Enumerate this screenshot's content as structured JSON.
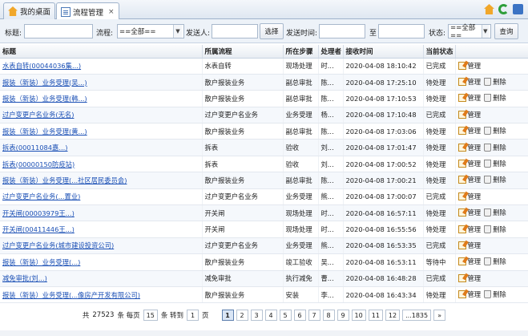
{
  "tabs": [
    {
      "label": "我的桌面",
      "icon": "home-icon"
    },
    {
      "label": "流程管理",
      "icon": "document-icon",
      "close": "×"
    }
  ],
  "search": {
    "title_label": "标题:",
    "flow_label": "流程:",
    "flow_value": "==全部==",
    "sender_label": "发送人:",
    "choose_button": "选择",
    "time_label": "发送时间:",
    "to_label": "至",
    "status_label": "状态:",
    "status_value": "==全部==",
    "query_button": "查询"
  },
  "columns": [
    "标题",
    "所属流程",
    "所在步骤",
    "处理者",
    "接收时间",
    "当前状态",
    ""
  ],
  "actions": {
    "manage": "管理",
    "delete": "删除"
  },
  "rows": [
    {
      "title": "水表自转(00044036集...)",
      "flow": "水表自转",
      "step": "现场处理",
      "handler": "时...",
      "time": "2020-04-08 18:10:42",
      "status": "已完成",
      "delete": false
    },
    {
      "title": "报装（新装）业务受理(吴...)",
      "flow": "散户报装业务",
      "step": "副总审批",
      "handler": "陈...",
      "time": "2020-04-08 17:25:10",
      "status": "待处理",
      "delete": true
    },
    {
      "title": "报装（新装）业务受理(韩...)",
      "flow": "散户报装业务",
      "step": "副总审批",
      "handler": "陈...",
      "time": "2020-04-08 17:10:53",
      "status": "待处理",
      "delete": true
    },
    {
      "title": "过户变更户名业务(无名)",
      "flow": "过户变更户名业务",
      "step": "业务受理",
      "handler": "杨...",
      "time": "2020-04-08 17:10:48",
      "status": "已完成",
      "delete": false
    },
    {
      "title": "报装（新装）业务受理(黄...)",
      "flow": "散户报装业务",
      "step": "副总审批",
      "handler": "陈...",
      "time": "2020-04-08 17:03:06",
      "status": "待处理",
      "delete": true
    },
    {
      "title": "拆表(00011084嘉...)",
      "flow": "拆表",
      "step": "验收",
      "handler": "刘...",
      "time": "2020-04-08 17:01:47",
      "status": "待处理",
      "delete": true
    },
    {
      "title": "拆表(00000150防疫站)",
      "flow": "拆表",
      "step": "验收",
      "handler": "刘...",
      "time": "2020-04-08 17:00:52",
      "status": "待处理",
      "delete": true
    },
    {
      "title": "报装（新装）业务受理(...社区居民委员会)",
      "flow": "散户报装业务",
      "step": "副总审批",
      "handler": "陈...",
      "time": "2020-04-08 17:00:21",
      "status": "待处理",
      "delete": true
    },
    {
      "title": "过户变更户名业务(...置业)",
      "flow": "过户变更户名业务",
      "step": "业务受理",
      "handler": "熊...",
      "time": "2020-04-08 17:00:07",
      "status": "已完成",
      "delete": false
    },
    {
      "title": "开关闸(00003979王...)",
      "flow": "开关闸",
      "step": "现场处理",
      "handler": "时...",
      "time": "2020-04-08 16:57:11",
      "status": "待处理",
      "delete": true
    },
    {
      "title": "开关闸(00411446王...)",
      "flow": "开关闸",
      "step": "现场处理",
      "handler": "时...",
      "time": "2020-04-08 16:55:56",
      "status": "待处理",
      "delete": true
    },
    {
      "title": "过户变更户名业务(城市建设投资公司)",
      "flow": "过户变更户名业务",
      "step": "业务受理",
      "handler": "熊...",
      "time": "2020-04-08 16:53:35",
      "status": "已完成",
      "delete": false
    },
    {
      "title": "报装（新装）业务受理(...)",
      "flow": "散户报装业务",
      "step": "竣工验收",
      "handler": "吴...",
      "time": "2020-04-08 16:53:11",
      "status": "等待中",
      "delete": true
    },
    {
      "title": "减免审批(刘...)",
      "flow": "减免审批",
      "step": "执行减免",
      "handler": "曹...",
      "time": "2020-04-08 16:48:28",
      "status": "已完成",
      "delete": false
    },
    {
      "title": "报装（新装）业务受理(...像房产开发有限公司)",
      "flow": "散户报装业务",
      "step": "安装",
      "handler": "李...",
      "time": "2020-04-08 16:43:34",
      "status": "待处理",
      "delete": true
    }
  ],
  "pager": {
    "total_prefix": "共",
    "total": "27523",
    "per_page_text": "条 每页",
    "page_size": "15",
    "goto_text": "条 转到",
    "goto_page": "1",
    "page_suffix": "页",
    "pages": [
      "1",
      "2",
      "3",
      "4",
      "5",
      "6",
      "7",
      "8",
      "9",
      "10",
      "11",
      "12",
      "...1835",
      "»"
    ],
    "current": "1"
  }
}
